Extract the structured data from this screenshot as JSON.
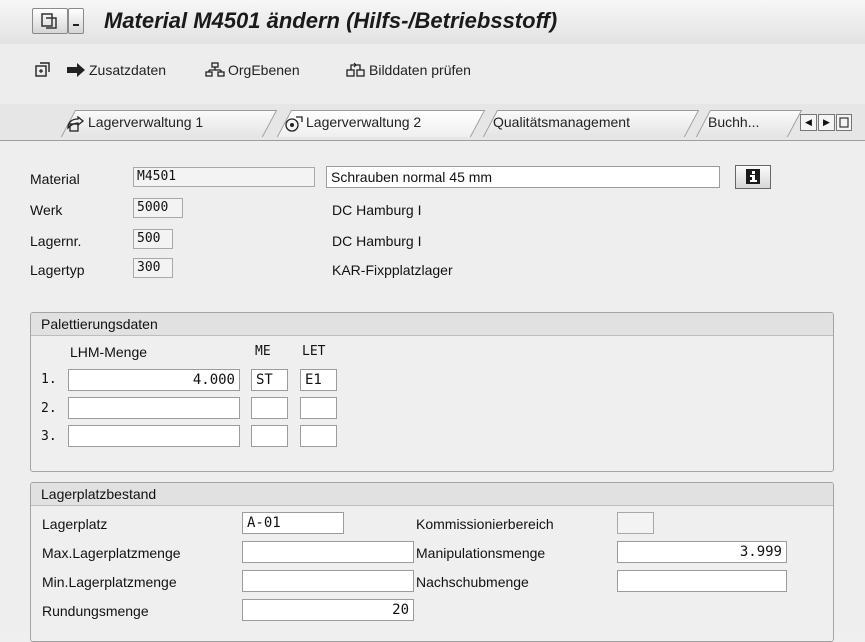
{
  "window": {
    "title": "Material M4501 ändern (Hilfs-/Betriebsstoff)"
  },
  "toolbar": {
    "zusatzdaten": "Zusatzdaten",
    "orgebenen": "OrgEbenen",
    "bilddaten": "Bilddaten prüfen"
  },
  "tabs": [
    {
      "label": "Lagerverwaltung 1"
    },
    {
      "label": "Lagerverwaltung 2"
    },
    {
      "label": "Qualitätsmanagement"
    },
    {
      "label": "Buchh..."
    }
  ],
  "header": {
    "material_label": "Material",
    "material_value": "M4501",
    "material_desc": "Schrauben normal 45 mm",
    "werk_label": "Werk",
    "werk_value": "5000",
    "werk_desc": "DC Hamburg I",
    "lagernr_label": "Lagernr.",
    "lagernr_value": "500",
    "lagernr_desc": "DC Hamburg I",
    "lagertyp_label": "Lagertyp",
    "lagertyp_value": "300",
    "lagertyp_desc": "KAR-Fixpplatzlager"
  },
  "palett": {
    "title": "Palettierungsdaten",
    "col_lhm": "LHM-Menge",
    "col_me": "ME",
    "col_let": "LET",
    "rows": [
      {
        "num": "1.",
        "lhm": "4.000",
        "me": "ST",
        "let": "E1"
      },
      {
        "num": "2.",
        "lhm": "",
        "me": "",
        "let": ""
      },
      {
        "num": "3.",
        "lhm": "",
        "me": "",
        "let": ""
      }
    ]
  },
  "lager": {
    "title": "Lagerplatzbestand",
    "lagerplatz_label": "Lagerplatz",
    "lagerplatz_value": "A-01",
    "maxmenge_label": "Max.Lagerplatzmenge",
    "maxmenge_value": "",
    "minmenge_label": "Min.Lagerplatzmenge",
    "minmenge_value": "",
    "rundung_label": "Rundungsmenge",
    "rundung_value": "20",
    "komm_label": "Kommissionierbereich",
    "komm_value": "",
    "manip_label": "Manipulationsmenge",
    "manip_value": "3.999",
    "nachschub_label": "Nachschubmenge",
    "nachschub_value": ""
  }
}
